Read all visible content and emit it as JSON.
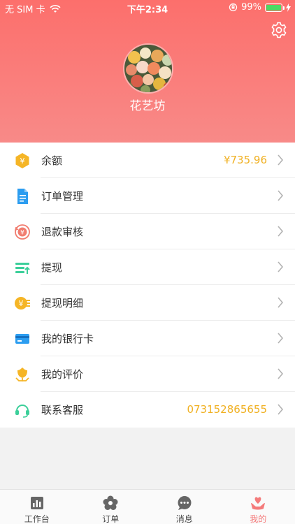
{
  "status_bar": {
    "carrier": "无 SIM 卡",
    "time": "下午2:34",
    "battery": "99%",
    "battery_level": 0.99
  },
  "header": {
    "shop_name": "花艺坊"
  },
  "menu": [
    {
      "label": "余额",
      "value": "¥735.96",
      "icon": "balance-coin-icon",
      "color": "#f5b526"
    },
    {
      "label": "订单管理",
      "value": "",
      "icon": "document-icon",
      "color": "#2c9df0"
    },
    {
      "label": "退款审核",
      "value": "",
      "icon": "refund-icon",
      "color": "#f17c6f"
    },
    {
      "label": "提现",
      "value": "",
      "icon": "withdraw-icon",
      "color": "#3ccf9a"
    },
    {
      "label": "提现明细",
      "value": "",
      "icon": "withdraw-detail-icon",
      "color": "#f5b526"
    },
    {
      "label": "我的银行卡",
      "value": "",
      "icon": "bank-card-icon",
      "color": "#2c9df0"
    },
    {
      "label": "我的评价",
      "value": "",
      "icon": "review-icon",
      "color": "#f5b526"
    },
    {
      "label": "联系客服",
      "value": "07315286565​5",
      "icon": "headset-icon",
      "color": "#3ccf9a"
    }
  ],
  "tabbar": [
    {
      "label": "工作台",
      "icon": "bar-chart-icon",
      "active": false
    },
    {
      "label": "订单",
      "icon": "flower-icon",
      "active": false
    },
    {
      "label": "消息",
      "icon": "chat-bubble-icon",
      "active": false
    },
    {
      "label": "我的",
      "icon": "hand-heart-icon",
      "active": true
    }
  ],
  "colors": {
    "header_top": "#fc6f6c",
    "header_bottom": "#f88a88",
    "accent_value": "#f0b021",
    "active_tab": "#f47b7b"
  }
}
